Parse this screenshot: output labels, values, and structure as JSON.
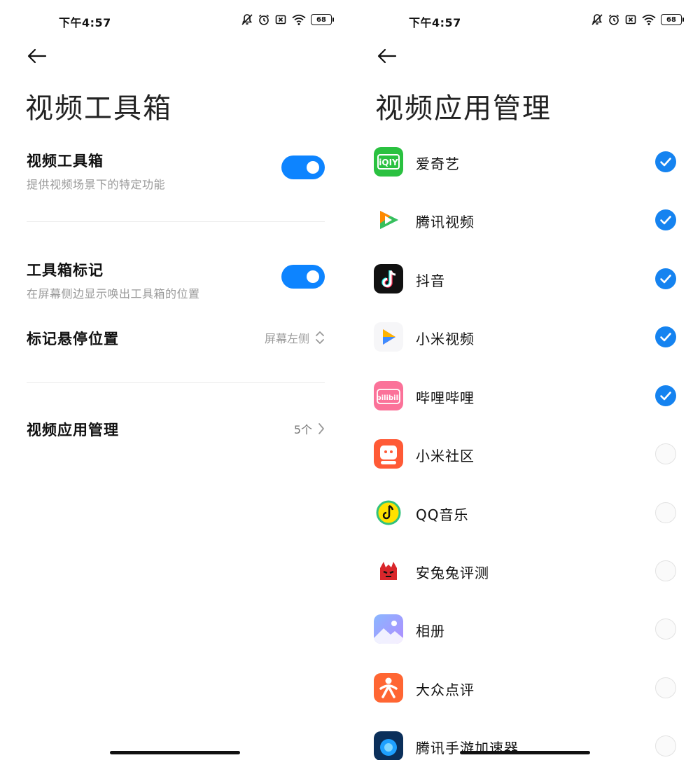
{
  "status": {
    "time": "下午4:57",
    "battery": "68"
  },
  "left": {
    "title": "视频工具箱",
    "settings": [
      {
        "title": "视频工具箱",
        "desc": "提供视频场景下的特定功能",
        "toggle": true
      },
      {
        "title": "工具箱标记",
        "desc": "在屏幕侧边显示唤出工具箱的位置",
        "toggle": true
      }
    ],
    "hover_position": {
      "title": "标记悬停位置",
      "value": "屏幕左侧"
    },
    "app_management": {
      "title": "视频应用管理",
      "value": "5个"
    }
  },
  "right": {
    "title": "视频应用管理",
    "apps": [
      {
        "name": "爱奇艺",
        "checked": true,
        "icon": "iqiyi-icon"
      },
      {
        "name": "腾讯视频",
        "checked": true,
        "icon": "tencent-video-icon"
      },
      {
        "name": "抖音",
        "checked": true,
        "icon": "douyin-icon"
      },
      {
        "name": "小米视频",
        "checked": true,
        "icon": "mi-video-icon"
      },
      {
        "name": "哔哩哔哩",
        "checked": true,
        "icon": "bilibili-icon"
      },
      {
        "name": "小米社区",
        "checked": false,
        "icon": "mi-community-icon"
      },
      {
        "name": "QQ音乐",
        "checked": false,
        "icon": "qq-music-icon"
      },
      {
        "name": "安兔兔评测",
        "checked": false,
        "icon": "antutu-icon"
      },
      {
        "name": "相册",
        "checked": false,
        "icon": "gallery-icon"
      },
      {
        "name": "大众点评",
        "checked": false,
        "icon": "dianping-icon"
      },
      {
        "name": "腾讯手游加速器",
        "checked": false,
        "icon": "game-accelerator-icon"
      }
    ]
  },
  "colors": {
    "accent": "#0d84ff",
    "check": "#1583f0"
  }
}
